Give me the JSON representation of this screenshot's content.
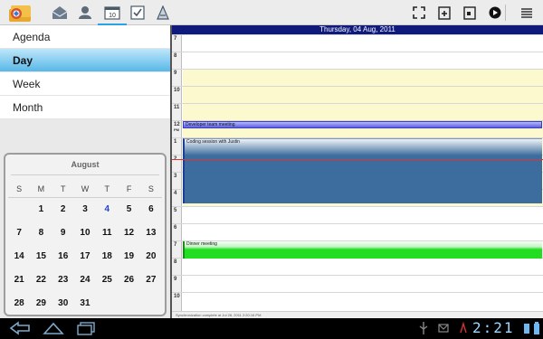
{
  "toolbar": {
    "icons": [
      "app-logo",
      "inbox-icon",
      "contacts-icon",
      "calendar-icon",
      "tasks-icon",
      "notes-icon"
    ],
    "right_icons": [
      "fullscreen-icon",
      "new-event-icon",
      "go-to-date-icon",
      "play-icon",
      "menu-icon"
    ]
  },
  "views": [
    {
      "label": "Agenda",
      "selected": false
    },
    {
      "label": "Day",
      "selected": true
    },
    {
      "label": "Week",
      "selected": false
    },
    {
      "label": "Month",
      "selected": false
    }
  ],
  "mini_calendar": {
    "month": "August",
    "weekdays": [
      "S",
      "M",
      "T",
      "W",
      "T",
      "F",
      "S"
    ],
    "weeks": [
      [
        "",
        "1",
        "2",
        "3",
        "4",
        "5",
        "6"
      ],
      [
        "7",
        "8",
        "9",
        "10",
        "11",
        "12",
        "13"
      ],
      [
        "14",
        "15",
        "16",
        "17",
        "18",
        "19",
        "20"
      ],
      [
        "21",
        "22",
        "23",
        "24",
        "25",
        "26",
        "27"
      ],
      [
        "28",
        "29",
        "30",
        "31",
        "",
        "",
        ""
      ]
    ],
    "today": "4"
  },
  "day_view": {
    "date_title": "Thursday, 04 Aug, 2011",
    "hours": [
      {
        "label": "7",
        "work": false
      },
      {
        "label": "8",
        "work": false
      },
      {
        "label": "9",
        "work": true
      },
      {
        "label": "10",
        "work": true
      },
      {
        "label": "11",
        "work": true
      },
      {
        "label": "12",
        "pm": "PM",
        "work": true
      },
      {
        "label": "1",
        "work": true
      },
      {
        "label": "2",
        "work": true
      },
      {
        "label": "3",
        "work": true
      },
      {
        "label": "4",
        "work": true
      },
      {
        "label": "5",
        "work": false
      },
      {
        "label": "6",
        "work": false
      },
      {
        "label": "7",
        "work": false
      },
      {
        "label": "8",
        "work": false
      },
      {
        "label": "9",
        "work": false
      },
      {
        "label": "10",
        "work": false
      }
    ],
    "events": [
      {
        "title": "Developer team meeting",
        "color": "#5a5ee0"
      },
      {
        "title": "Coding session with Justin",
        "color": "#3d6d9e"
      },
      {
        "title": "Dinner meeting",
        "color": "#22dd22"
      }
    ],
    "status": "Synchronization complete    at Jul 28, 2011 2:20:16 PM"
  },
  "system_bar": {
    "clock": "2:21",
    "nav": [
      "back-icon",
      "home-icon",
      "recent-apps-icon"
    ]
  },
  "colors": {
    "header": "#0f1a7a",
    "selected_view": "#57b8e8",
    "work_hours": "#fdf9cf",
    "today": "#2244cc"
  }
}
